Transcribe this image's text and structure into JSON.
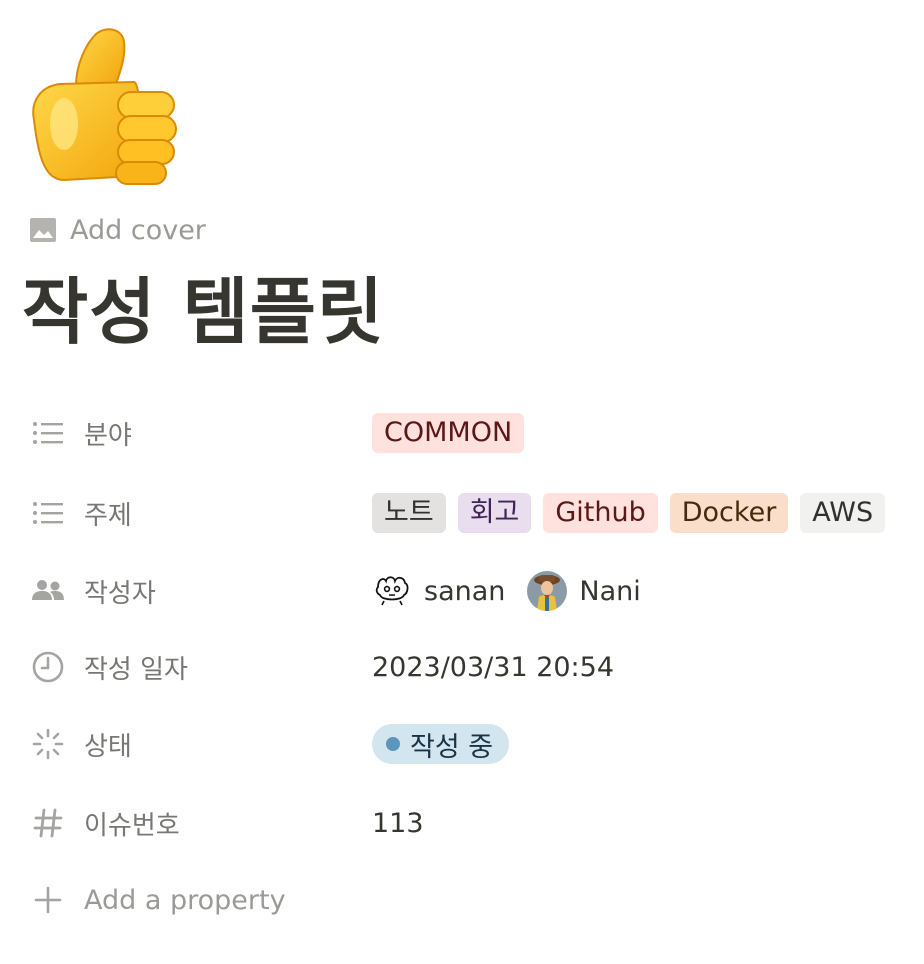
{
  "page": {
    "icon": "thumbs-up-emoji",
    "add_cover_label": "Add cover",
    "title": "작성 템플릿"
  },
  "properties": {
    "field": {
      "name": "분야",
      "icon": "list-icon",
      "tags": [
        {
          "label": "COMMON",
          "bg": "#ffe2dd",
          "fg": "#5d1715"
        }
      ]
    },
    "topic": {
      "name": "주제",
      "icon": "list-icon",
      "tags": [
        {
          "label": "노트",
          "bg": "#e3e2e0",
          "fg": "#32302c"
        },
        {
          "label": "회고",
          "bg": "#e8deee",
          "fg": "#412454"
        },
        {
          "label": "Github",
          "bg": "#ffe2dd",
          "fg": "#5d1715"
        },
        {
          "label": "Docker",
          "bg": "#fadec9",
          "fg": "#49290e"
        },
        {
          "label": "AWS",
          "bg": "#f1f1ef",
          "fg": "#32302c"
        }
      ]
    },
    "authors": {
      "name": "작성자",
      "icon": "people-icon",
      "people": [
        {
          "name": "sanan",
          "avatar": "doodle-avatar"
        },
        {
          "name": "Nani",
          "avatar": "woody-avatar"
        }
      ]
    },
    "created": {
      "name": "작성 일자",
      "icon": "clock-icon",
      "value": "2023/03/31 20:54"
    },
    "status": {
      "name": "상태",
      "icon": "status-spinner-icon",
      "value": "작성 중",
      "bg": "#d3e5ef",
      "fg": "#183347",
      "dot": "#5b97bd"
    },
    "issue_number": {
      "name": "이슈번호",
      "icon": "hash-icon",
      "value": "113"
    }
  },
  "add_property_label": "Add a property",
  "colors": {
    "text": "#37352f",
    "muted": "#787774",
    "placeholder": "#9b9a97"
  }
}
